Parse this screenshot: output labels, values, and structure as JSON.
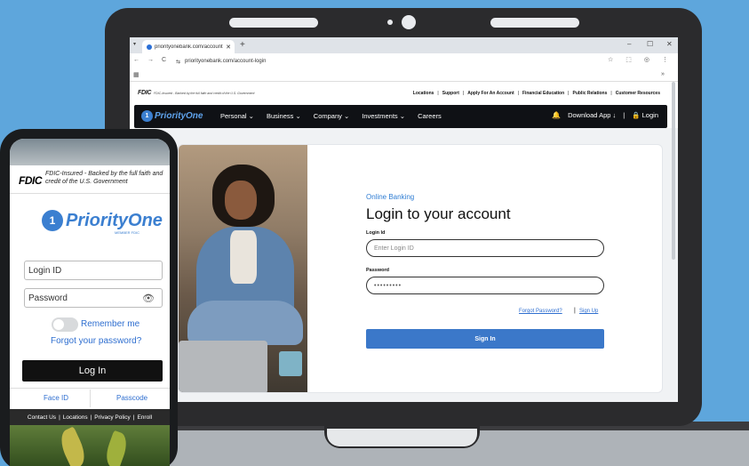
{
  "browser": {
    "tab_title": "priorityonebank.com/account-l",
    "tab_close": "✕",
    "new_tab": "+",
    "tab_menu": "▾",
    "url": "priorityonebank.com/account-login",
    "nav_back": "←",
    "nav_forward": "→",
    "nav_reload": "C",
    "site_info": "⇆",
    "star": "☆",
    "extensions": "⬚",
    "profile": "◎",
    "menu": "⋮",
    "apps": "▦",
    "bookmarks_more": "»",
    "win_min": "–",
    "win_max": "☐",
    "win_close": "✕"
  },
  "site": {
    "fdic": "FDIC",
    "fdic_text": "FDIC-Insured - Backed by the full faith and credit of the U.S. Government",
    "top_links": [
      "Locations",
      "Support",
      "Apply For An Account",
      "Financial Education",
      "Public Relations",
      "Customer Resources"
    ],
    "logo_mark": "1",
    "logo_text": "PriorityOne",
    "nav": [
      "Personal ⌄",
      "Business ⌄",
      "Company ⌄",
      "Investments ⌄",
      "Careers"
    ],
    "bell": "🔔",
    "download_app": "Download App ↓",
    "nav_sep": "|",
    "login": "🔒 Login"
  },
  "login_form": {
    "section_label": "Online Banking",
    "title": "Login to your account",
    "login_id_label": "Login Id",
    "login_id_placeholder": "Enter Login ID",
    "password_label": "Password",
    "password_value": "•••••••••",
    "forgot": "Forgot Password?",
    "separator": "|",
    "signup": "Sign Up",
    "signin": "Sign In"
  },
  "phone": {
    "fdic": "FDIC",
    "fdic_text": "FDIC-Insured - Backed by the full faith and credit of the U.S. Government",
    "logo_mark": "1",
    "logo_text": "PriorityOne",
    "member": "MEMBER FDIC",
    "login_id": "Login ID",
    "password": "Password",
    "eye": "👁",
    "remember": "Remember me",
    "forgot": "Forgot your password?",
    "login_button": "Log In",
    "face_id": "Face ID",
    "passcode": "Passcode",
    "footer": [
      "Contact Us",
      "|",
      "Locations",
      "|",
      "Privacy Policy",
      "|",
      "Enroll"
    ]
  }
}
